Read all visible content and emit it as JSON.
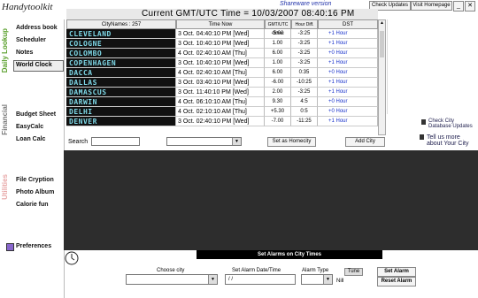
{
  "header": {
    "logo": "Handytoolkit",
    "shareware": "Shareware version",
    "check_updates": "Check Updates",
    "visit_homepage": "Visit Homepage",
    "gmt_time": "Current GMT/UTC Time = 10/03/2007 08:40:16 PM"
  },
  "sidebar": {
    "daily_lookup": "Daily Lookup",
    "financial": "Financial",
    "utilities": "Utilities",
    "items": [
      {
        "label": "Address book"
      },
      {
        "label": "Scheduler"
      },
      {
        "label": "Notes"
      },
      {
        "label": "World Clock"
      },
      {
        "label": "Budget Sheet"
      },
      {
        "label": "EasyCalc"
      },
      {
        "label": "Loan Calc"
      },
      {
        "label": "File Cryption"
      },
      {
        "label": "Photo Album"
      },
      {
        "label": "Calorie fun"
      },
      {
        "label": "Preferences"
      }
    ]
  },
  "table": {
    "headers": {
      "city": "CityNames : 257",
      "time": "Time Now",
      "offset": "GMT/UTC Offset",
      "diff": "Hour Diff.",
      "dst": "DST"
    },
    "rows": [
      {
        "city": "CLEVELAND",
        "time": "3 Oct. 04:40:10 PM [Wed]",
        "offset": "-5.00",
        "diff": "-3:25",
        "dst": "+1 Hour"
      },
      {
        "city": "COLOGNE",
        "time": "3 Oct. 10:40:10 PM [Wed]",
        "offset": "1.00",
        "diff": "-3:25",
        "dst": "+1 Hour"
      },
      {
        "city": "COLOMBO",
        "time": "4 Oct. 02:40:10 AM [Thu]",
        "offset": "6.00",
        "diff": "-3:25",
        "dst": "+0 Hour"
      },
      {
        "city": "COPENHAGEN",
        "time": "3 Oct. 10:40:10 PM [Wed]",
        "offset": "1.00",
        "diff": "-3:25",
        "dst": "+1 Hour"
      },
      {
        "city": "DACCA",
        "time": "4 Oct. 02:40:10 AM [Thu]",
        "offset": "6.00",
        "diff": "0:35",
        "dst": "+0 Hour"
      },
      {
        "city": "DALLAS",
        "time": "3 Oct. 03:40:10 PM [Wed]",
        "offset": "-6.00",
        "diff": "-10:25",
        "dst": "+1 Hour"
      },
      {
        "city": "DAMASCUS",
        "time": "3 Oct. 11:40:10 PM [Wed]",
        "offset": "2.00",
        "diff": "-3:25",
        "dst": "+1 Hour"
      },
      {
        "city": "DARWIN",
        "time": "4 Oct. 06:10:10 AM [Thu]",
        "offset": "9.30",
        "diff": "4:5",
        "dst": "+0 Hour"
      },
      {
        "city": "DELHI",
        "time": "4 Oct. 02:10:10 AM [Thu]",
        "offset": "+5.30",
        "diff": "0:5",
        "dst": "+0 Hour"
      },
      {
        "city": "DENVER",
        "time": "3 Oct. 02:40:10 PM [Wed]",
        "offset": "-7.00",
        "diff": "-11:25",
        "dst": "+1 Hour"
      }
    ]
  },
  "right_panel": {
    "check_db": "Check City Database Updates",
    "tell_us": "Tell us more about Your City"
  },
  "controls": {
    "search_label": "Search",
    "search_value": "",
    "set_homecity": "Set as Homecity",
    "add_city": "Add City"
  },
  "alarms": {
    "title": "Set Alarms on City Times",
    "choose_city_label": "Choose city",
    "date_label": "Set Alarm Date/Time",
    "date_value": "/ /",
    "type_label": "Alarm Type",
    "tune_button": "Tune",
    "nill": "Nill",
    "set_alarm": "Set Alarm",
    "reset_alarm": "Reset Alarm"
  }
}
